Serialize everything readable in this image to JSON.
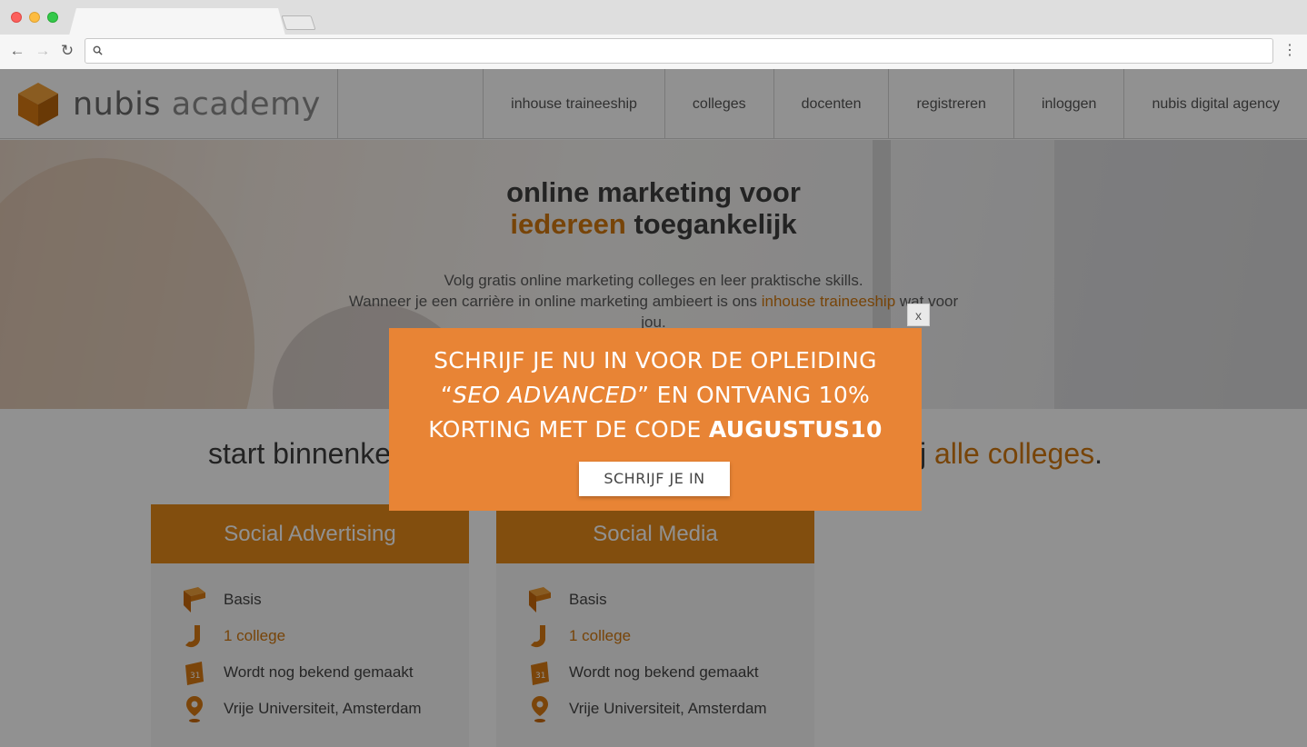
{
  "browser": {
    "address_value": "",
    "back_glyph": "←",
    "forward_glyph": "→",
    "reload_glyph": "↻",
    "menu_glyph": "⋮"
  },
  "site": {
    "logo": {
      "word1": "nubis",
      "word2": "academy"
    },
    "nav": [
      {
        "label": "inhouse traineeship"
      },
      {
        "label": "colleges"
      },
      {
        "label": "docenten"
      },
      {
        "label": "registreren"
      },
      {
        "label": "inloggen"
      },
      {
        "label": "nubis digital agency"
      }
    ]
  },
  "hero": {
    "title_line1": "online marketing voor",
    "title_accent": "iedereen",
    "title_rest": " toegankelijk",
    "text_line1": "Volg gratis online marketing colleges en leer praktische skills.",
    "text_line2_before": "Wanneer je een carrière in online marketing ambieert is ons ",
    "text_line2_link": "inhouse traineeship",
    "text_line2_after": " wat voor jou."
  },
  "start_section": {
    "left_text": "start binnenke",
    "right_prefix": "ij ",
    "right_accent": "alle colleges",
    "right_suffix": "."
  },
  "cards": [
    {
      "title": "Social Advertising",
      "level": "Basis",
      "count": "1 college",
      "date": "Wordt nog bekend gemaakt",
      "location": "Vrije Universiteit, Amsterdam"
    },
    {
      "title": "Social Media",
      "level": "Basis",
      "count": "1 college",
      "date": "Wordt nog bekend gemaakt",
      "location": "Vrije Universiteit, Amsterdam"
    }
  ],
  "modal": {
    "line1": "SCHRIJF JE NU IN VOOR DE OPLEIDING",
    "line2_quote_open": "“",
    "line2_italic": "SEO ADVANCED",
    "line2_rest": "” EN ONTVANG 10%",
    "line3_prefix": "KORTING MET DE CODE ",
    "line3_code": "AUGUSTUS10",
    "button_label": "SCHRIJF JE IN",
    "close_label": "x"
  },
  "colors": {
    "brand_orange": "#e48a1a",
    "modal_orange": "#e88435",
    "accent_text": "#d2780f"
  }
}
